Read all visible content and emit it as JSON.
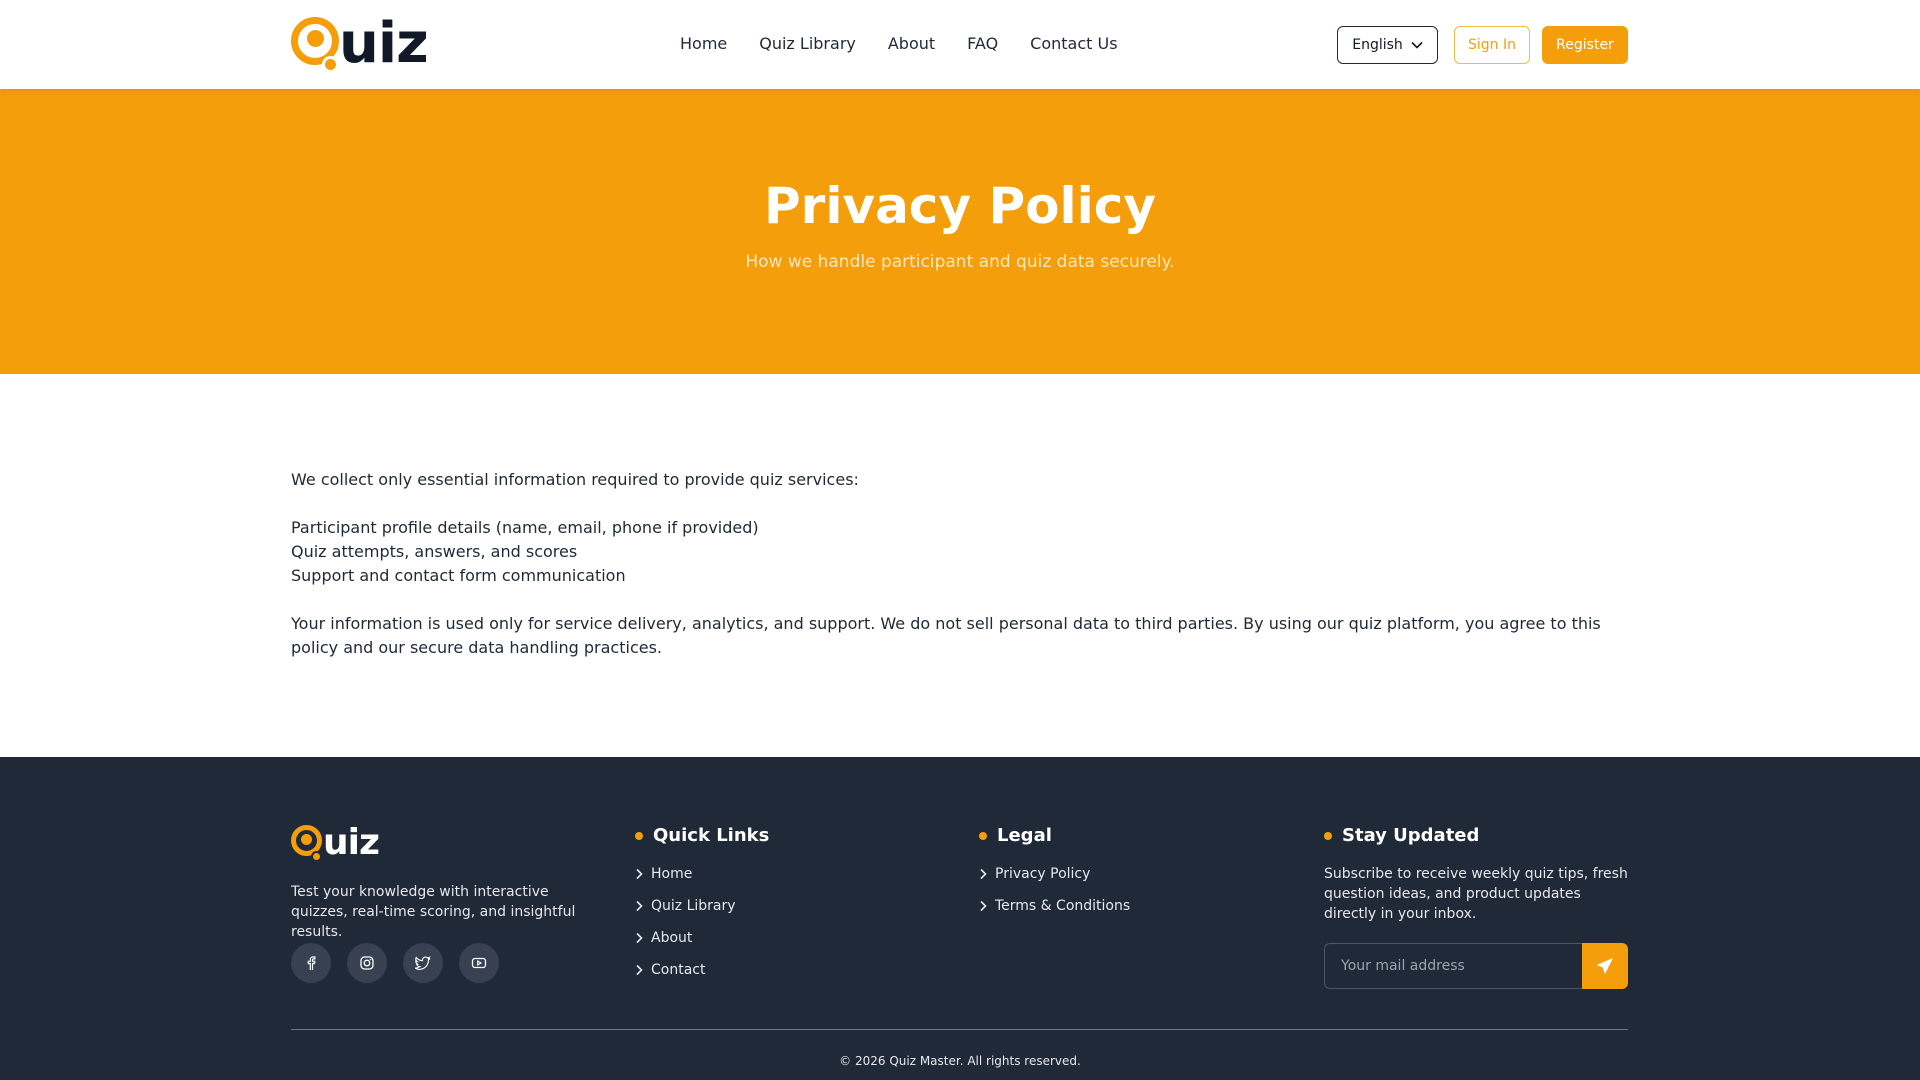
{
  "header": {
    "logo_text": "uiz",
    "nav": [
      "Home",
      "Quiz Library",
      "About",
      "FAQ",
      "Contact Us"
    ],
    "language": "English",
    "sign_in": "Sign In",
    "register": "Register"
  },
  "hero": {
    "title": "Privacy Policy",
    "subtitle": "How we handle participant and quiz data securely."
  },
  "content": {
    "intro": "We collect only essential information required to provide quiz services:",
    "items": [
      "Participant profile details (name, email, phone if provided)",
      "Quiz attempts, answers, and scores",
      "Support and contact form communication"
    ],
    "closing": "Your information is used only for service delivery, analytics, and support. We do not sell personal data to third parties. By using our quiz platform, you agree to this policy and our secure data handling practices."
  },
  "footer": {
    "logo_text": "uiz",
    "description": "Test your knowledge with interactive quizzes, real-time scoring, and insightful results.",
    "socials": [
      "facebook-icon",
      "instagram-icon",
      "twitter-icon",
      "youtube-icon"
    ],
    "quick_links": {
      "title": "Quick Links",
      "items": [
        "Home",
        "Quiz Library",
        "About",
        "Contact"
      ]
    },
    "legal": {
      "title": "Legal",
      "items": [
        "Privacy Policy",
        "Terms & Conditions"
      ]
    },
    "stay_updated": {
      "title": "Stay Updated",
      "text": "Subscribe to receive weekly quiz tips, fresh question ideas, and product updates directly in your inbox.",
      "placeholder": "Your mail address"
    },
    "copyright": "© 2026 Quiz Master. All rights reserved."
  },
  "colors": {
    "accent": "#f59e0b",
    "footer_bg": "#1f2937",
    "text_dark": "#1f2937"
  }
}
